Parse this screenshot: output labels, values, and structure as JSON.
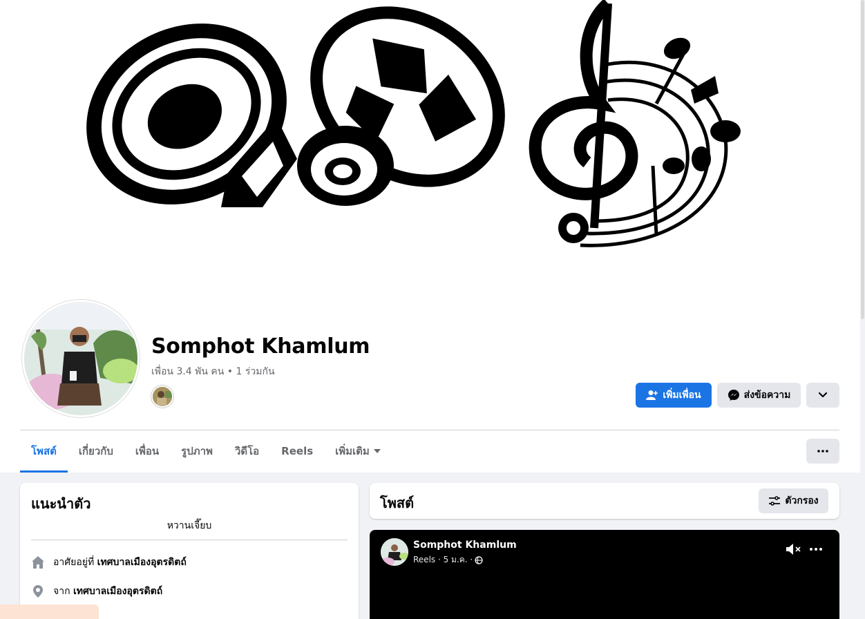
{
  "profile": {
    "name": "Somphot Khamlum",
    "friends_line": "เพื่อน 3.4 พัน คน • 1 ร่วมกัน"
  },
  "actions": {
    "add_friend": "เพิ่มเพื่อน",
    "message": "ส่งข้อความ"
  },
  "tabs": [
    {
      "label": "โพสต์",
      "active": true
    },
    {
      "label": "เกี่ยวกับ",
      "active": false
    },
    {
      "label": "เพื่อน",
      "active": false
    },
    {
      "label": "รูปภาพ",
      "active": false
    },
    {
      "label": "วิดีโอ",
      "active": false
    },
    {
      "label": "Reels",
      "active": false
    },
    {
      "label": "เพิ่มเติม",
      "active": false
    }
  ],
  "intro": {
    "title": "แนะนำตัว",
    "bio": "หวานเจี๊ยบ",
    "lives_prefix": "อาศัยอยู่ที่",
    "lives_place": "เทศบาลเมืองอุตรดิตถ์",
    "from_prefix": "จาก",
    "from_place": "เทศบาลเมืองอุตรดิตถ์"
  },
  "posts": {
    "title": "โพสต์",
    "filter_label": "ตัวกรอง"
  },
  "reel": {
    "author": "Somphot Khamlum",
    "meta": "Reels · 5 ม.ค. ·"
  },
  "colors": {
    "accent": "#1b74e4",
    "secondary_button": "#e4e6eb",
    "page_bg": "#f0f2f5"
  },
  "icons": [
    "add-friend-icon",
    "messenger-icon",
    "chevron-down-icon",
    "more-dots-icon",
    "filter-icon",
    "home-icon",
    "location-pin-icon",
    "muted-speaker-icon",
    "globe-icon",
    "caret-down-icon"
  ]
}
